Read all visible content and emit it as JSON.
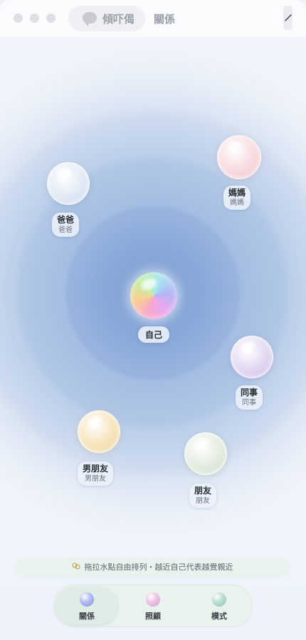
{
  "window": {
    "tabs": [
      {
        "label": "傾吓偈",
        "icon": "chat-bubble-icon",
        "active": true
      },
      {
        "label": "關係",
        "active": false
      }
    ],
    "edit_icon": "pencil-icon"
  },
  "stage": {
    "center": {
      "label": "自己"
    },
    "people": [
      {
        "name": "爸爸",
        "sub": "爸爸",
        "color": "#c5d4e8"
      },
      {
        "name": "媽媽",
        "sub": "媽媽",
        "color": "#eebfc6"
      },
      {
        "name": "同事",
        "sub": "同事",
        "color": "#c9b6e6"
      },
      {
        "name": "男朋友",
        "sub": "男朋友",
        "color": "#edcf8e"
      },
      {
        "name": "朋友",
        "sub": "朋友",
        "color": "#c8d9c3"
      }
    ]
  },
  "hint": {
    "icon": "hand-drag-icon",
    "text": "拖拉水點自由排列・越近自己代表越覺親近"
  },
  "nav": {
    "items": [
      {
        "label": "關係",
        "active": true,
        "color": "#7f8fe0"
      },
      {
        "label": "照顧",
        "active": false,
        "color": "#d89bd1"
      },
      {
        "label": "模式",
        "active": false,
        "color": "#8ec2ae"
      }
    ]
  }
}
